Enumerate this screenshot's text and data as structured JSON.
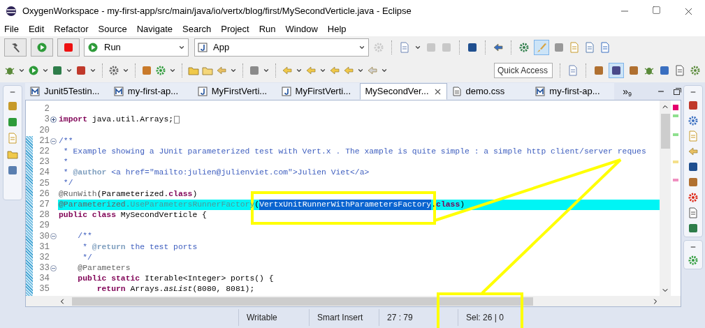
{
  "window": {
    "title": "OxygenWorkspace - my-first-app/src/main/java/io/vertx/blog/first/MySecondVerticle.java - Eclipse"
  },
  "menu": [
    "File",
    "Edit",
    "Refactor",
    "Source",
    "Navigate",
    "Search",
    "Project",
    "Run",
    "Window",
    "Help"
  ],
  "toolbar": {
    "launch_mode": "Run",
    "launch_config": "App",
    "quick_access": {
      "placeholder": "Quick Access"
    }
  },
  "tabs": [
    {
      "label": "Junit5Testin...",
      "kind": "module",
      "selected": false
    },
    {
      "label": "my-first-ap...",
      "kind": "module",
      "selected": false
    },
    {
      "label": "MyFirstVerti...",
      "kind": "java",
      "selected": false
    },
    {
      "label": "MyFirstVerti...",
      "kind": "java",
      "selected": false
    },
    {
      "label": "MySecondVer...",
      "kind": "java-error",
      "selected": true
    },
    {
      "label": "demo.css",
      "kind": "text",
      "selected": false
    },
    {
      "label": "my-first-ap...",
      "kind": "module",
      "selected": false
    }
  ],
  "tab_overflow": {
    "symbol": "»",
    "count": "9"
  },
  "editor": {
    "lines": [
      {
        "number": "2"
      },
      {
        "number": "3",
        "collapsed": true,
        "segments": [
          {
            "kind": "keyword",
            "text": "import"
          },
          {
            "kind": "plain",
            "text": " java.util.Arrays;"
          }
        ]
      },
      {
        "number": "20"
      },
      {
        "number": "21",
        "collapsed": false,
        "segments": [
          {
            "kind": "comment",
            "text": "/**"
          }
        ]
      },
      {
        "number": "22",
        "segments": [
          {
            "kind": "comment",
            "text": " * Example showing a JUnit parameterized test with Vert.x . The xample is quite simple : a simple http client/server reques"
          }
        ]
      },
      {
        "number": "23",
        "segments": [
          {
            "kind": "comment",
            "text": " *"
          }
        ]
      },
      {
        "number": "24",
        "segments": [
          {
            "kind": "comment",
            "text": " * "
          },
          {
            "kind": "tag",
            "text": "@author"
          },
          {
            "kind": "comment",
            "text": " <a href=\"mailto:julien@julienviet.com\">Julien Viet</a>"
          }
        ]
      },
      {
        "number": "25",
        "segments": [
          {
            "kind": "comment",
            "text": " */"
          }
        ]
      },
      {
        "number": "26",
        "segments": [
          {
            "kind": "annotation",
            "text": "@RunWith"
          },
          {
            "kind": "plain",
            "text": "(Parameterized."
          },
          {
            "kind": "keyword",
            "text": "class"
          },
          {
            "kind": "plain",
            "text": ")"
          }
        ]
      },
      {
        "number": "27",
        "highlighted": true,
        "segments": [
          {
            "kind": "annotation",
            "text": "@Parameterized."
          },
          {
            "kind": "member",
            "text": "UseParametersRunnerFactory"
          },
          {
            "kind": "plain",
            "text": "("
          },
          {
            "kind": "selected",
            "text": "VertxUnitRunnerWithParametersFactory"
          },
          {
            "kind": "plain",
            "text": "."
          },
          {
            "kind": "keyword",
            "text": "class"
          },
          {
            "kind": "plain",
            "text": ")"
          }
        ]
      },
      {
        "number": "28",
        "segments": [
          {
            "kind": "keyword",
            "text": "public class"
          },
          {
            "kind": "plain",
            "text": " MySecondVerticle {"
          }
        ]
      },
      {
        "number": "29"
      },
      {
        "number": "30",
        "collapsed": false,
        "segments": [
          {
            "kind": "comment",
            "text": "    /**"
          }
        ]
      },
      {
        "number": "31",
        "segments": [
          {
            "kind": "comment",
            "text": "     * "
          },
          {
            "kind": "tag",
            "text": "@return"
          },
          {
            "kind": "comment",
            "text": " the test ports"
          }
        ]
      },
      {
        "number": "32",
        "segments": [
          {
            "kind": "comment",
            "text": "     */"
          }
        ]
      },
      {
        "number": "33",
        "collapsed": false,
        "segments": [
          {
            "kind": "annotation",
            "text": "    @Parameters"
          }
        ]
      },
      {
        "number": "34",
        "segments": [
          {
            "kind": "keyword",
            "text": "    public static"
          },
          {
            "kind": "plain",
            "text": " Iterable<Integer> ports() {"
          }
        ]
      },
      {
        "number": "35",
        "segments": [
          {
            "kind": "keyword",
            "text": "        return"
          },
          {
            "kind": "plain",
            "text": " Arrays."
          },
          {
            "kind": "static",
            "text": "asList"
          },
          {
            "kind": "plain",
            "text": "(8080, 8081);"
          }
        ]
      }
    ]
  },
  "status_bar": [
    "Writable",
    "Smart Insert",
    "27 : 79",
    "Sel: 26 | 0"
  ]
}
